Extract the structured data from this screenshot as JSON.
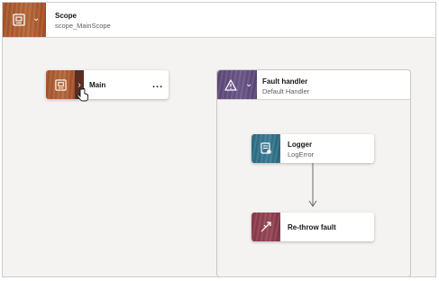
{
  "scope": {
    "title": "Scope",
    "name": "scope_MainScope",
    "icon": "scope-node-icon"
  },
  "main_node": {
    "title": "Main",
    "icon": "scope-node-icon",
    "expand_icon": "chevron-right-icon",
    "more_label": "..."
  },
  "fault_handler": {
    "title": "Fault handler",
    "subtitle": "Default Handler",
    "icon": "warning-triangle-icon",
    "toggle_icon": "chevron-down-icon"
  },
  "logger": {
    "title": "Logger",
    "subtitle": "LogError",
    "icon": "logger-icon"
  },
  "rethrow": {
    "title": "Re-throw fault",
    "icon": "rethrow-arrow-icon"
  },
  "colors": {
    "scope_accent": "#a8562c",
    "fault_accent": "#5e4a7a",
    "logger_accent": "#2f6f86",
    "rethrow_accent": "#8a3a4a",
    "canvas_bg": "#f4f3f2"
  }
}
